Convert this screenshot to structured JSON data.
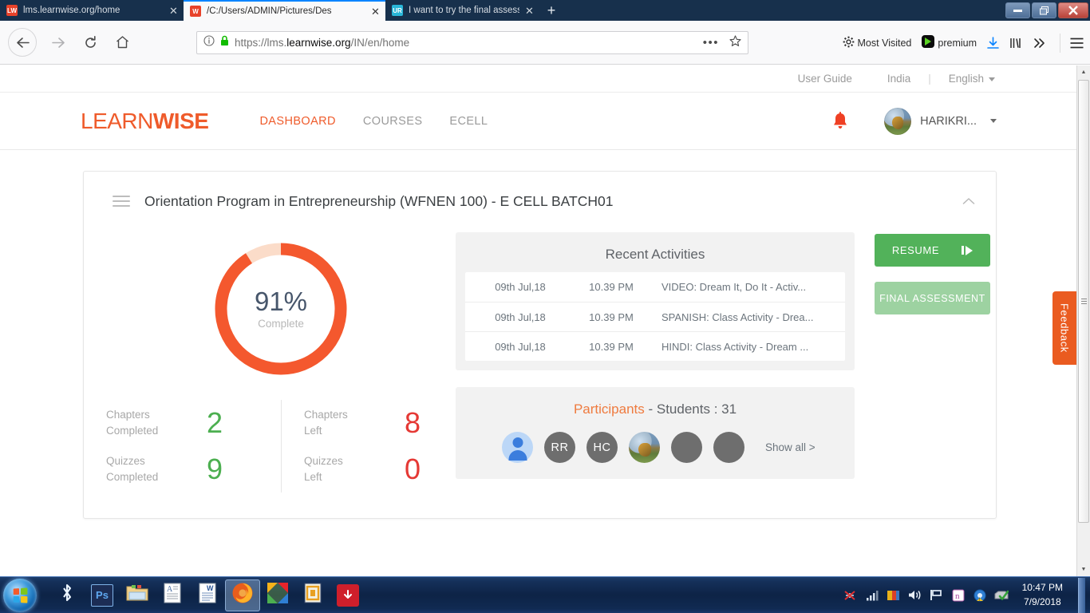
{
  "browser": {
    "tabs": [
      {
        "title": "lms.learnwise.org/home",
        "favicon_label": "LW",
        "favicon_color": "#e8422a",
        "active": false
      },
      {
        "title": "/C:/Users/ADMIN/Pictures/Des",
        "favicon_label": "W",
        "favicon_color": "#e8422a",
        "active": true
      },
      {
        "title": "I want to try the final assessme",
        "favicon_label": "UR",
        "favicon_color": "#29b6d8",
        "active": false
      }
    ],
    "new_tab_label": "+",
    "close_label": "✕",
    "window_controls": {
      "minimize": "—",
      "maximize": "❐",
      "close": "✕"
    },
    "nav": {
      "back": "←",
      "forward": "→",
      "reload": "⟳",
      "home": "⌂"
    },
    "url": {
      "scheme": "https://",
      "host_dim": "lms.",
      "host_bold": "learnwise.org",
      "path": "/IN/en/home",
      "info_icon": "ⓘ",
      "lock_icon": "lock"
    },
    "toolbar_right": [
      {
        "label": "Most Visited",
        "icon": "gear-icon"
      },
      {
        "label": "premium",
        "icon": "premium-icon"
      },
      {
        "label": "",
        "icon": "download-icon"
      },
      {
        "label": "",
        "icon": "library-icon"
      },
      {
        "label": "",
        "icon": "overflow-icon"
      },
      {
        "label": "",
        "icon": "menu-icon"
      }
    ]
  },
  "topbar": {
    "user_guide": "User Guide",
    "country": "India",
    "divider": "|",
    "language": "English"
  },
  "header": {
    "logo_part1": "LEARN",
    "logo_part2": "WISE",
    "nav": [
      {
        "label": "DASHBOARD",
        "active": true
      },
      {
        "label": "COURSES",
        "active": false
      },
      {
        "label": "ECELL",
        "active": false
      }
    ],
    "user_name": "HARIKRI...",
    "bell_icon": "notification-bell-icon"
  },
  "course_card": {
    "title": "Orientation Program in Entrepreneurship (WFNEN 100) - E CELL BATCH01",
    "collapse_icon": "chevron-up-icon",
    "menu_icon": "hamburger-icon",
    "progress": {
      "percent": 91,
      "percent_label": "91%",
      "sub_label": "Complete",
      "ring_color": "#f4582e",
      "track_color": "#fbdcc9"
    },
    "stats": [
      {
        "name": "Chapters\nCompleted",
        "line1": "Chapters",
        "line2": "Completed",
        "value": "2",
        "tone": "green"
      },
      {
        "name": "Chapters Left",
        "line1": "Chapters",
        "line2": "Left",
        "value": "8",
        "tone": "red"
      },
      {
        "name": "Quizzes Completed",
        "line1": "Quizzes",
        "line2": "Completed",
        "value": "9",
        "tone": "green"
      },
      {
        "name": "Quizzes Left",
        "line1": "Quizzes",
        "line2": "Left",
        "value": "0",
        "tone": "red"
      }
    ],
    "recent_activities": {
      "title": "Recent Activities",
      "rows": [
        {
          "date": "09th Jul,18",
          "time": "10.39 PM",
          "name": "VIDEO: Dream It, Do It - Activ..."
        },
        {
          "date": "09th Jul,18",
          "time": "10.39 PM",
          "name": "SPANISH: Class Activity - Drea..."
        },
        {
          "date": "09th Jul,18",
          "time": "10.39 PM",
          "name": "HINDI: Class Activity - Dream ..."
        }
      ]
    },
    "participants": {
      "title_orange": "Participants",
      "title_rest": " - Students : 31",
      "avatars": [
        {
          "type": "default-user",
          "initials": ""
        },
        {
          "type": "initials",
          "initials": "RR"
        },
        {
          "type": "initials",
          "initials": "HC"
        },
        {
          "type": "photo",
          "initials": ""
        },
        {
          "type": "blank",
          "initials": ""
        },
        {
          "type": "blank",
          "initials": ""
        }
      ],
      "show_all": "Show all >"
    },
    "actions": {
      "resume": "RESUME",
      "final_assessment": "FINAL ASSESSMENT"
    }
  },
  "feedback_tab": {
    "label": "Feedback",
    "color": "#ea5b20"
  },
  "taskbar": {
    "start_label": "Start",
    "items": [
      {
        "name": "bluetooth",
        "label": "✳"
      },
      {
        "name": "photoshop",
        "label": "Ps"
      },
      {
        "name": "file-explorer",
        "label": ""
      },
      {
        "name": "text-document",
        "label": "A"
      },
      {
        "name": "word",
        "label": "W"
      },
      {
        "name": "firefox",
        "label": "",
        "active": true
      },
      {
        "name": "picasa",
        "label": ""
      },
      {
        "name": "foxit-reader",
        "label": ""
      },
      {
        "name": "downloader",
        "label": "↓"
      }
    ],
    "tray": [
      "network-error-icon",
      "signal-icon",
      "files-icon",
      "volume-icon",
      "flag-icon",
      "onenote-icon",
      "warning-icon",
      "check-icon"
    ],
    "time": "10:47 PM",
    "date": "7/9/2018"
  }
}
